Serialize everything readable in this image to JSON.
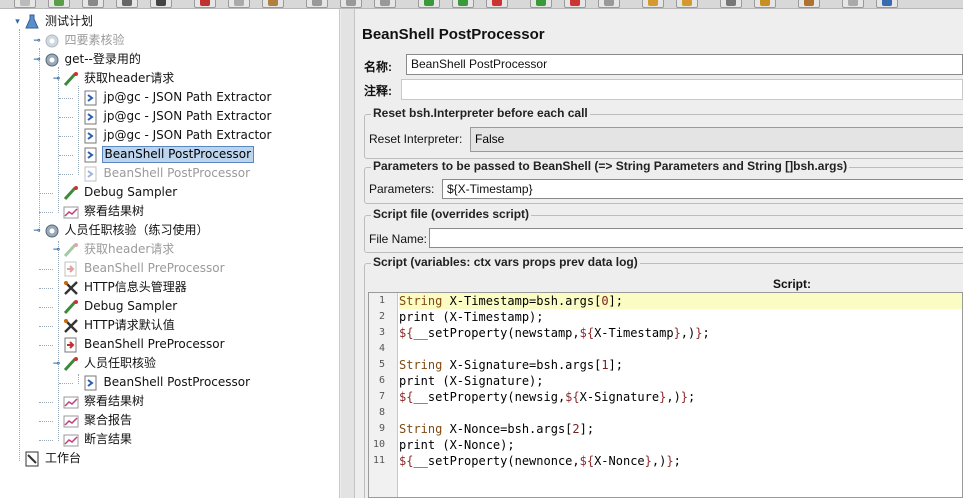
{
  "colors": {
    "selection": "#bcd4ee",
    "current_line": "#fbfbc4",
    "disabled_text": "#9a9a9a"
  },
  "tree": {
    "items": [
      {
        "label": "测试计划",
        "icon": "test-plan-icon",
        "disabled": false
      },
      {
        "label": "四要素核验",
        "icon": "thread-group-icon",
        "disabled": true
      },
      {
        "label": "get--登录用的",
        "icon": "thread-group-icon",
        "disabled": false
      },
      {
        "label": "获取header请求",
        "icon": "sampler-icon",
        "disabled": false
      },
      {
        "label": "jp@gc - JSON Path Extractor",
        "icon": "post-processor-icon",
        "disabled": false
      },
      {
        "label": "jp@gc - JSON Path Extractor",
        "icon": "post-processor-icon",
        "disabled": false
      },
      {
        "label": "jp@gc - JSON Path Extractor",
        "icon": "post-processor-icon",
        "disabled": false
      },
      {
        "label": "BeanShell PostProcessor",
        "icon": "post-processor-icon",
        "disabled": false,
        "selected": true
      },
      {
        "label": "BeanShell PostProcessor",
        "icon": "post-processor-icon",
        "disabled": true
      },
      {
        "label": "Debug Sampler",
        "icon": "sampler-icon",
        "disabled": false
      },
      {
        "label": "察看结果树",
        "icon": "listener-icon",
        "disabled": false
      },
      {
        "label": "人员任职核验（练习使用）",
        "icon": "thread-group-icon",
        "disabled": false
      },
      {
        "label": "获取header请求",
        "icon": "sampler-icon",
        "disabled": true
      },
      {
        "label": "BeanShell PreProcessor",
        "icon": "pre-processor-icon",
        "disabled": true
      },
      {
        "label": "HTTP信息头管理器",
        "icon": "config-element-icon",
        "disabled": false
      },
      {
        "label": "Debug Sampler",
        "icon": "sampler-icon",
        "disabled": false
      },
      {
        "label": "HTTP请求默认值",
        "icon": "config-element-icon",
        "disabled": false
      },
      {
        "label": "BeanShell PreProcessor",
        "icon": "pre-processor-icon",
        "disabled": false
      },
      {
        "label": "人员任职核验",
        "icon": "sampler-icon",
        "disabled": false
      },
      {
        "label": "BeanShell PostProcessor",
        "icon": "post-processor-icon",
        "disabled": false
      },
      {
        "label": "察看结果树",
        "icon": "listener-icon",
        "disabled": false
      },
      {
        "label": "聚合报告",
        "icon": "listener-icon",
        "disabled": false
      },
      {
        "label": "断言结果",
        "icon": "listener-icon",
        "disabled": false
      },
      {
        "label": "工作台",
        "icon": "workbench-icon",
        "disabled": false
      }
    ]
  },
  "panel": {
    "title": "BeanShell PostProcessor",
    "name_label": "名称:",
    "name_value": "BeanShell PostProcessor",
    "comment_label": "注释:",
    "comment_value": "",
    "reset_group_title": "Reset bsh.Interpreter before each call",
    "reset_label": "Reset Interpreter:",
    "reset_value": "False",
    "params_group_title": "Parameters to be passed to BeanShell (=> String Parameters and String []bsh.args)",
    "params_label": "Parameters:",
    "params_value": "${X-Timestamp}",
    "file_group_title": "Script file (overrides script)",
    "file_label": "File Name:",
    "file_value": "",
    "script_group_title": "Script (variables: ctx vars props prev data log)",
    "script_header": "Script:"
  },
  "script": {
    "lines": [
      "String X-Timestamp=bsh.args[0];",
      "print (X-Timestamp);",
      "${__setProperty(newstamp,${X-Timestamp},)};",
      "",
      "String X-Signature=bsh.args[1];",
      "print (X-Signature);",
      "${__setProperty(newsig,${X-Signature},)};",
      "",
      "String X-Nonce=bsh.args[2];",
      "print (X-Nonce);",
      "${__setProperty(newnonce,${X-Nonce},)};"
    ],
    "line_numbers": [
      "1",
      "2",
      "3",
      "4",
      "5",
      "6",
      "7",
      "8",
      "9",
      "10",
      "11"
    ],
    "current_line": 1
  }
}
